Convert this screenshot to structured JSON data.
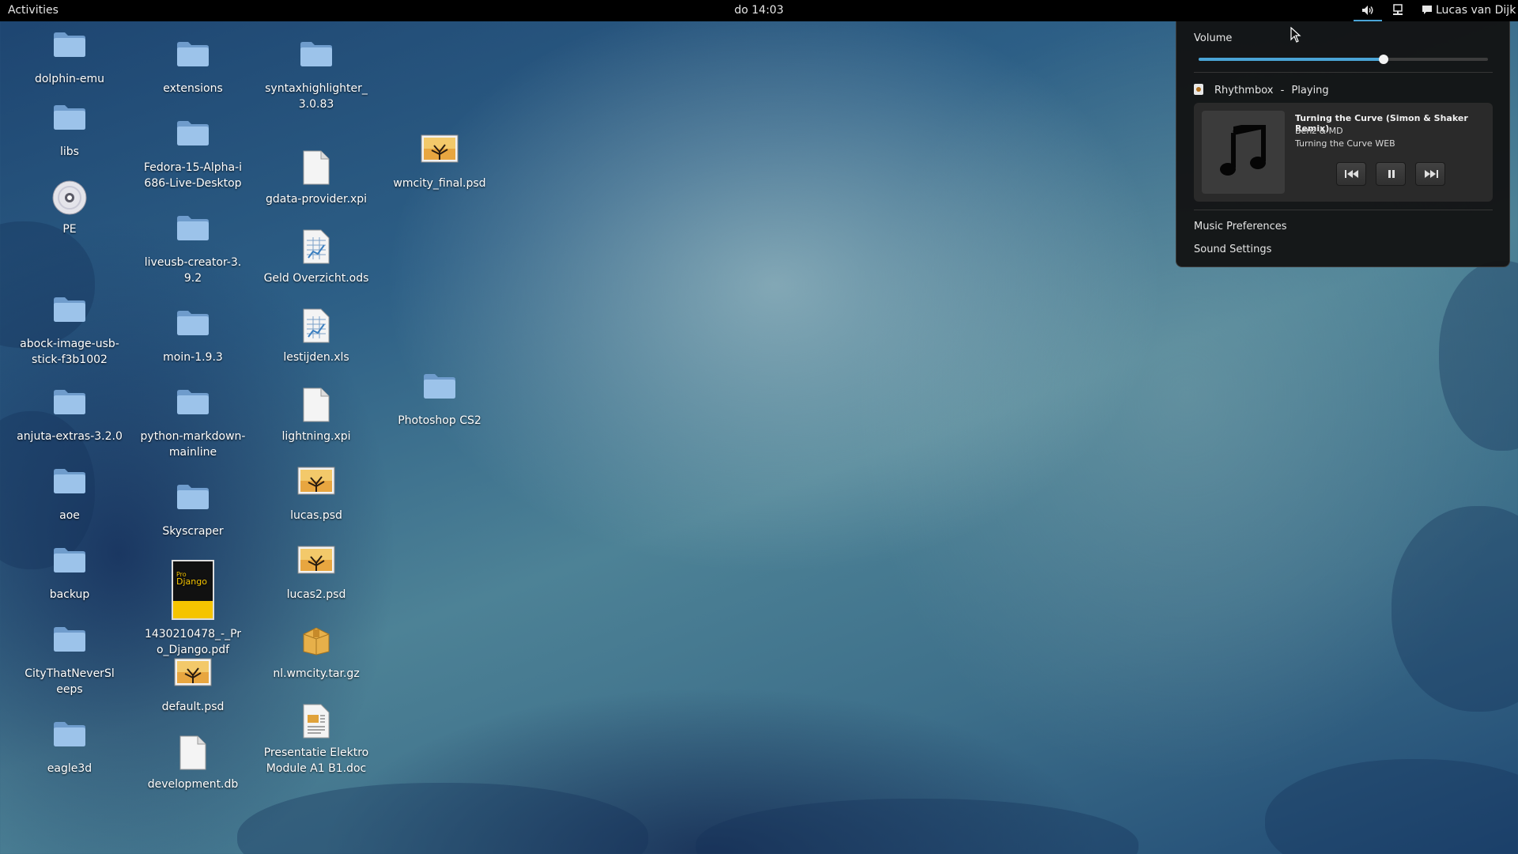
{
  "topbar": {
    "activities": "Activities",
    "clock": "do 14:03",
    "user": "Lucas van Dijk"
  },
  "volume_popup": {
    "volume_label": "Volume",
    "volume_level": 0.64,
    "player": {
      "app": "Rhythmbox",
      "separator": "-",
      "status": "Playing",
      "track_title": "Turning the Curve (Simon & Shaker Remix)",
      "artist": "Benz & MD",
      "album": "Turning the Curve WEB"
    },
    "menu": {
      "music_preferences": "Music Preferences",
      "sound_settings": "Sound Settings"
    }
  },
  "desktop": {
    "icons": [
      {
        "label": "dolphin-emu",
        "type": "folder"
      },
      {
        "label": "libs",
        "type": "folder"
      },
      {
        "label": "PE",
        "type": "disc"
      },
      {
        "label": "abock-image-usb-stick-f3b1002",
        "type": "folder"
      },
      {
        "label": "anjuta-extras-3.2.0",
        "type": "folder"
      },
      {
        "label": "aoe",
        "type": "folder"
      },
      {
        "label": "backup",
        "type": "folder"
      },
      {
        "label": "CityThatNeverSleeps",
        "type": "folder"
      },
      {
        "label": "eagle3d",
        "type": "folder"
      },
      {
        "label": "extensions",
        "type": "folder"
      },
      {
        "label": "Fedora-15-Alpha-i686-Live-Desktop",
        "type": "folder"
      },
      {
        "label": "liveusb-creator-3.9.2",
        "type": "folder"
      },
      {
        "label": "moin-1.9.3",
        "type": "folder"
      },
      {
        "label": "python-markdown-mainline",
        "type": "folder"
      },
      {
        "label": "Skyscraper",
        "type": "folder"
      },
      {
        "label": "1430210478_-_Pro_Django.pdf",
        "type": "pdf-book"
      },
      {
        "label": "default.psd",
        "type": "image"
      },
      {
        "label": "development.db",
        "type": "document"
      },
      {
        "label": "syntaxhighlighter_3.0.83",
        "type": "folder"
      },
      {
        "label": "gdata-provider.xpi",
        "type": "document"
      },
      {
        "label": "Geld Overzicht.ods",
        "type": "spreadsheet"
      },
      {
        "label": "lestijden.xls",
        "type": "spreadsheet"
      },
      {
        "label": "lightning.xpi",
        "type": "document"
      },
      {
        "label": "lucas.psd",
        "type": "image"
      },
      {
        "label": "lucas2.psd",
        "type": "image"
      },
      {
        "label": "nl.wmcity.tar.gz",
        "type": "archive"
      },
      {
        "label": "Presentatie Elektro Module A1 B1.doc",
        "type": "word-document"
      },
      {
        "label": "wmcity_final.psd",
        "type": "image"
      },
      {
        "label": "Photoshop CS2",
        "type": "folder"
      }
    ],
    "pdf_cover": {
      "line1": "Pro",
      "line2": "Django"
    }
  },
  "colors": {
    "topbar_bg": "#000000",
    "accent": "#4aa4d6",
    "popup_bg": "#121212",
    "folder": "#9cc3ea"
  }
}
